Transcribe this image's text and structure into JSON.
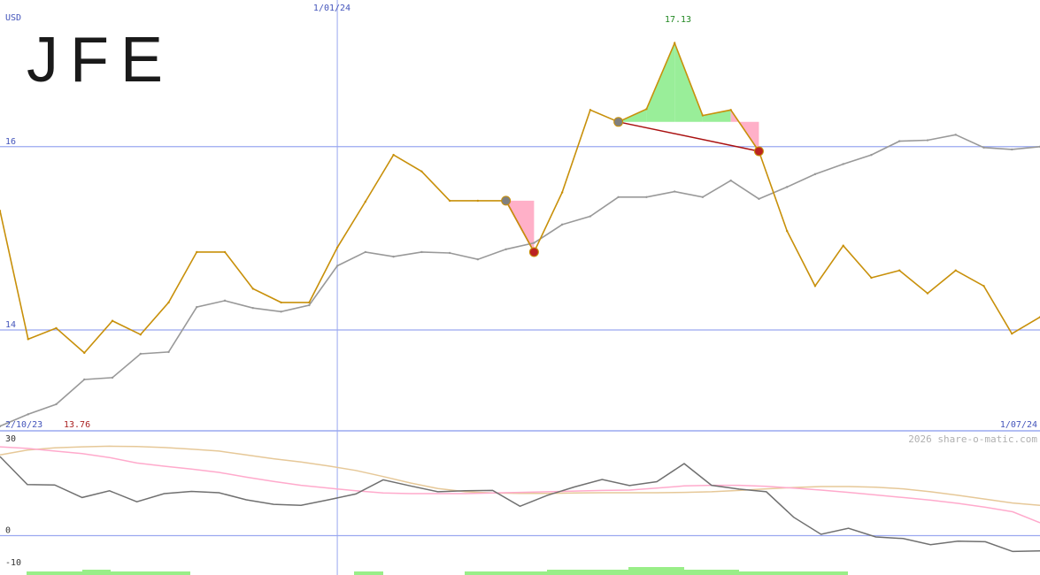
{
  "chart_data": [
    {
      "type": "line",
      "title": "JFE",
      "currency": "USD",
      "ylim": [
        12.9,
        17.6
      ],
      "y_ticks": [
        {
          "value": 16,
          "label": "16"
        },
        {
          "value": 14,
          "label": "14"
        }
      ],
      "x_labels": {
        "start": "2/10/23",
        "divider": "1/01/24",
        "end": "1/07/24"
      },
      "divider_index": 12,
      "min_label": "13.76",
      "max_label": "17.13",
      "watermark": "2026 share-o-matic.com",
      "colors": {
        "price": "#c8900a",
        "comparison": "#999999",
        "grid": "#9aa8f0",
        "axis_text": "#4455bb",
        "max_text": "#228822",
        "min_text": "#aa2222",
        "gain": "#99ee99",
        "loss": "#ffb0c8",
        "trend": "#aa1111"
      },
      "series": [
        {
          "key": "price",
          "values": [
            15.3,
            13.9,
            14.02,
            13.75,
            14.1,
            13.95,
            14.3,
            14.85,
            14.85,
            14.45,
            14.3,
            14.3,
            14.9,
            15.4,
            15.91,
            15.73,
            15.41,
            15.41,
            15.41,
            14.85,
            15.5,
            16.4,
            16.27,
            16.41,
            17.13,
            16.34,
            16.4,
            15.95,
            15.08,
            14.48,
            14.92,
            14.57,
            14.65,
            14.4,
            14.65,
            14.48,
            13.96,
            14.14
          ]
        },
        {
          "key": "comparison",
          "values": [
            12.95,
            13.08,
            13.19,
            13.46,
            13.48,
            13.74,
            13.76,
            14.25,
            14.32,
            14.24,
            14.2,
            14.27,
            14.7,
            14.85,
            14.8,
            14.85,
            14.84,
            14.77,
            14.88,
            14.95,
            15.15,
            15.24,
            15.45,
            15.45,
            15.51,
            15.45,
            15.63,
            15.43,
            15.56,
            15.7,
            15.81,
            15.91,
            16.06,
            16.07,
            16.13,
            15.99,
            15.97,
            16.0
          ]
        }
      ],
      "markers": [
        {
          "index": 18,
          "kind": "open"
        },
        {
          "index": 19,
          "kind": "close"
        },
        {
          "index": 22,
          "kind": "open"
        },
        {
          "index": 27,
          "kind": "close"
        }
      ]
    },
    {
      "type": "line",
      "ylim": [
        -10,
        30
      ],
      "y_ticks": [
        {
          "value": 30,
          "label": "30"
        },
        {
          "value": 0,
          "label": "0"
        },
        {
          "value": -10,
          "label": "-10"
        }
      ],
      "series": [
        {
          "key": "momentum",
          "color": "#707070",
          "values": [
            24.5,
            15.8,
            15.7,
            11.8,
            13.9,
            10.5,
            13,
            13.7,
            13.3,
            11.1,
            9.7,
            9.4,
            11.1,
            12.9,
            17.3,
            15.4,
            13.6,
            13.9,
            14,
            9.1,
            12.5,
            15.1,
            17.4,
            15.5,
            16.7,
            22.3,
            15.6,
            14.4,
            13.6,
            5.7,
            0.4,
            2.3,
            -0.4,
            -0.9,
            -2.8,
            -1.7,
            -1.9,
            -4.9,
            -4.7
          ]
        },
        {
          "key": "avg-short",
          "color": "#ffaacc",
          "values": [
            27.5,
            27,
            26.2,
            25.4,
            24.2,
            22.5,
            21.5,
            20.6,
            19.6,
            18.1,
            16.8,
            15.6,
            14.7,
            13.9,
            13.2,
            13.0,
            13.0,
            13.0,
            13.2,
            13.4,
            13.6,
            13.8,
            14.0,
            14.1,
            14.7,
            15.4,
            15.6,
            15.6,
            15.3,
            14.7,
            14.1,
            13.4,
            12.6,
            11.8,
            11.0,
            10.0,
            8.8,
            7.4,
            4.0
          ]
        },
        {
          "key": "avg-long",
          "color": "#e6c898",
          "values": [
            25.0,
            26.5,
            27.2,
            27.5,
            27.7,
            27.6,
            27.3,
            26.8,
            26.2,
            25.0,
            23.8,
            22.8,
            21.6,
            20.2,
            18.3,
            16.3,
            14.6,
            13.6,
            13.2,
            13.1,
            13.1,
            13.2,
            13.3,
            13.3,
            13.3,
            13.4,
            13.6,
            14.0,
            14.5,
            14.9,
            15.2,
            15.2,
            15.0,
            14.5,
            13.6,
            12.5,
            11.3,
            10.1,
            9.4
          ]
        }
      ]
    }
  ]
}
